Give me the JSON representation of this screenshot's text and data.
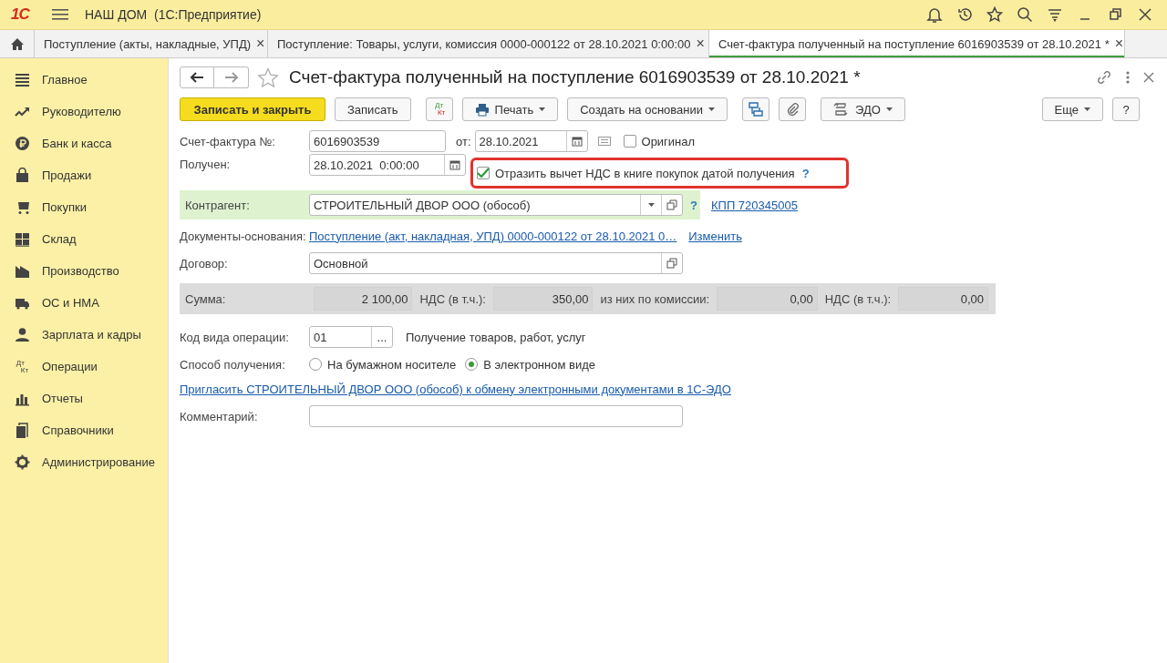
{
  "app": {
    "logo": "1С",
    "title": "НАШ ДОМ  (1С:Предприятие)"
  },
  "tabs": [
    {
      "label": "Поступление (акты, накладные, УПД)",
      "close": "×",
      "selected": false
    },
    {
      "label": "Поступление: Товары, услуги, комиссия 0000-000122 от 28.10.2021 0:00:00",
      "close": "×",
      "selected": false
    },
    {
      "label": "Счет-фактура полученный на поступление 6016903539 от 28.10.2021 *",
      "close": "×",
      "selected": true
    }
  ],
  "sidebar": {
    "items": [
      {
        "label": "Главное"
      },
      {
        "label": "Руководителю"
      },
      {
        "label": "Банк и касса"
      },
      {
        "label": "Продажи"
      },
      {
        "label": "Покупки"
      },
      {
        "label": "Склад"
      },
      {
        "label": "Производство"
      },
      {
        "label": "ОС и НМА"
      },
      {
        "label": "Зарплата и кадры"
      },
      {
        "label": "Операции",
        "icon_text": [
          "Дт",
          "Кт"
        ]
      },
      {
        "label": "Отчеты"
      },
      {
        "label": "Справочники"
      },
      {
        "label": "Администрирование"
      }
    ]
  },
  "form": {
    "title": "Счет-фактура полученный на поступление 6016903539 от 28.10.2021 *",
    "toolbar": [
      {
        "kind": "primary",
        "label": "Записать и закрыть"
      },
      {
        "kind": "plain",
        "label": "Записать"
      },
      {
        "kind": "dtkt",
        "text": [
          "Дт",
          "Кт"
        ]
      },
      {
        "kind": "print",
        "label": "Печать"
      },
      {
        "kind": "menu",
        "label": "Создать на основании"
      },
      {
        "kind": "struct"
      },
      {
        "kind": "clip"
      },
      {
        "kind": "edo",
        "label": "ЭДО"
      }
    ],
    "toolbar_right": [
      {
        "kind": "menu",
        "label": "Еще"
      },
      {
        "kind": "plain",
        "label": "?"
      }
    ],
    "invoice": {
      "label": "Счет-фактура №:",
      "value": "6016903539",
      "date_label": "от:",
      "date": "28.10.2021",
      "original": {
        "label": "Оригинал",
        "checked": false
      }
    },
    "received": {
      "label": "Получен:",
      "value": "28.10.2021  0:00:00",
      "deduct": {
        "label": "Отразить вычет НДС в книге покупок датой получения",
        "help": "?",
        "checked": true,
        "highlighted": true
      }
    },
    "counterparty": {
      "label": "Контрагент:",
      "value": "СТРОИТЕЛЬНЫЙ ДВОР ООО (обособ)",
      "help": "?",
      "kpp": "КПП 720345005"
    },
    "base_docs": {
      "label": "Документы-основания:",
      "link": "Поступление (акт, накладная, УПД) 0000-000122 от 28.10.2021 0…",
      "change": "Изменить"
    },
    "contract": {
      "label": "Договор:",
      "value": "Основной"
    },
    "totals": [
      {
        "label": "Сумма:",
        "value": "2 100,00"
      },
      {
        "label": "НДС (в т.ч.):",
        "value": "350,00"
      },
      {
        "label": "из них по комиссии:",
        "value": "0,00"
      },
      {
        "label": "НДС (в т.ч.):",
        "value": "0,00"
      }
    ],
    "operation_code": {
      "label": "Код вида операции:",
      "value": "01",
      "button": "...",
      "description": "Получение товаров, работ, услуг"
    },
    "receipt_method": {
      "label": "Способ получения:",
      "options": [
        {
          "label": "На бумажном носителе",
          "selected": false
        },
        {
          "label": "В электронном виде",
          "selected": true
        }
      ]
    },
    "invite_link": "Пригласить СТРОИТЕЛЬНЫЙ ДВОР ООО (обособ) к обмену электронными документами в 1С-ЭДО",
    "comment": {
      "label": "Комментарий:"
    }
  }
}
